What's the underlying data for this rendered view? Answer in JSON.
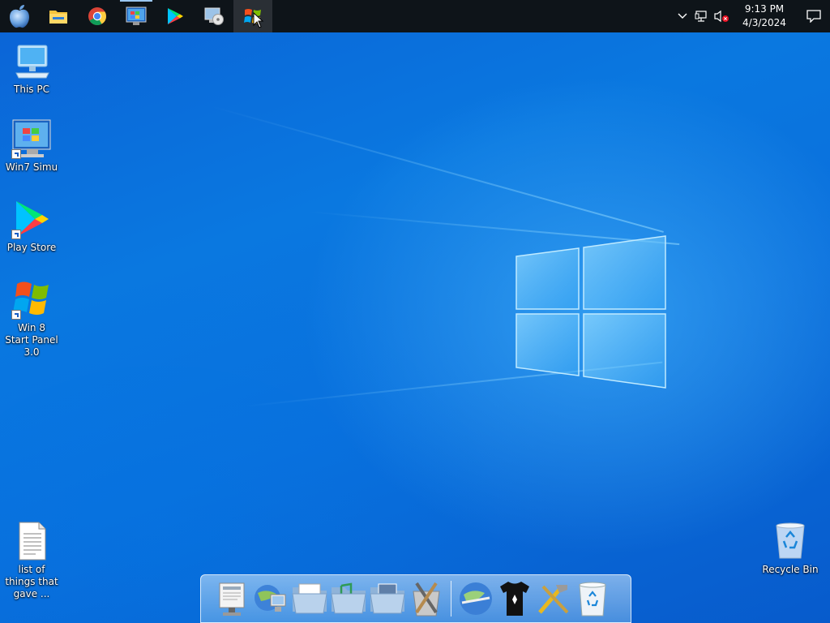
{
  "taskbar": {
    "start_icon": "apple-icon",
    "pinned": [
      {
        "name": "file-explorer",
        "icon": "folder-icon"
      },
      {
        "name": "chrome",
        "icon": "chrome-icon"
      },
      {
        "name": "win7-simu",
        "icon": "win7-simu-icon"
      },
      {
        "name": "play-store",
        "icon": "play-store-icon"
      },
      {
        "name": "disc-tool",
        "icon": "disc-icon"
      },
      {
        "name": "win8-start-panel",
        "icon": "windows-flag-icon"
      }
    ],
    "tray": {
      "clock_time": "9:13 PM",
      "clock_date": "4/3/2024"
    }
  },
  "desktop": {
    "icons": [
      {
        "label": "This PC",
        "icon": "computer-icon"
      },
      {
        "label": "Win7 Simu",
        "icon": "win7-simu-icon"
      },
      {
        "label": "Play Store",
        "icon": "play-store-icon"
      },
      {
        "label": "Win 8 Start Panel 3.0",
        "icon": "windows-flag-icon"
      },
      {
        "label": "list of things that gave ...",
        "icon": "text-document-icon"
      },
      {
        "label": "Recycle Bin",
        "icon": "recycle-bin-icon"
      }
    ]
  },
  "dock": {
    "items": [
      "preview-icon",
      "network-globe-icon",
      "documents-folder-icon",
      "music-folder-icon",
      "pictures-folder-icon",
      "utilities-icon",
      "internet-globe-icon",
      "tshirt-icon",
      "tools-icon",
      "trash-icon"
    ]
  },
  "colors": {
    "taskbar_bg": "#0e1419",
    "wallpaper_primary": "#0a78e0"
  }
}
